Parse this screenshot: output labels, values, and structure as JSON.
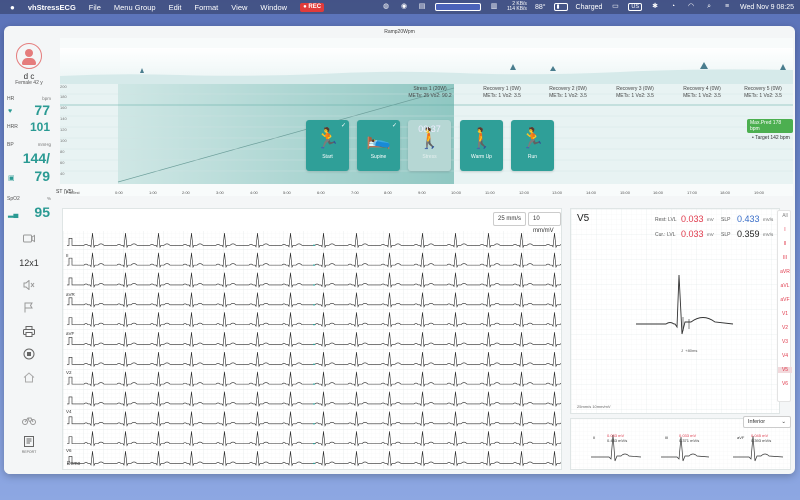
{
  "menubar": {
    "apple": "",
    "app_name": "vhStressECG",
    "menus": [
      "File",
      "Menu Group",
      "Edit",
      "Format",
      "View",
      "Window"
    ],
    "rec": "REC",
    "net_up": "2 KB/s",
    "net_down": "114 KB/s",
    "temperature": "88°",
    "battery": "Charged",
    "input_source": "US",
    "datetime": "Wed Nov 9  08:25"
  },
  "window": {
    "title": "Ramp20Wpm"
  },
  "patient": {
    "name": "d c",
    "info": "Female 42 y"
  },
  "vitals": [
    {
      "label": "HR",
      "unit": "bpm",
      "value": "77",
      "icon": "heart-icon"
    },
    {
      "label": "HRR",
      "unit": "",
      "value": "101",
      "icon": ""
    },
    {
      "label": "BP",
      "unit": "mmHg",
      "value": "144/",
      "icon": ""
    },
    {
      "label": "",
      "unit": "",
      "value": "79",
      "icon": "bp-cuff-icon"
    },
    {
      "label": "SpO2",
      "unit": "%",
      "value": "95",
      "icon": "signal-icon"
    }
  ],
  "sidebar_tools": {
    "video": "video-icon",
    "layout": "12x1",
    "mute": "mute-icon",
    "flag": "flag-icon",
    "print": "print-icon",
    "stop": "stop-icon",
    "home": "home-icon",
    "bike": "bike-icon",
    "report": "report-icon",
    "report_label": "REPORT"
  },
  "protocol": {
    "stages": [
      {
        "label": "Stress 1 (20W)",
        "mets": "METs: 25  Vo2: 90.2"
      },
      {
        "label": "Recovery 1 (0W)",
        "mets": "METs: 1  Vo2: 3.5"
      },
      {
        "label": "Recovery 2 (0W)",
        "mets": "METs: 1  Vo2: 3.5"
      },
      {
        "label": "Recovery 3 (0W)",
        "mets": "METs: 1  Vo2: 3.5"
      },
      {
        "label": "Recovery 4 (0W)",
        "mets": "METs: 1  Vo2: 3.5"
      },
      {
        "label": "Recovery 5 (0W)",
        "mets": "METs: 1  Vo2: 3.5"
      }
    ],
    "cards": [
      {
        "label": "Start",
        "icon": "run-start-icon",
        "checked": true,
        "dim": false
      },
      {
        "label": "Supine",
        "icon": "supine-icon",
        "checked": true,
        "dim": false
      },
      {
        "label": "Stress",
        "icon": "walk-icon",
        "checked": false,
        "dim": true,
        "timer": "00:37"
      },
      {
        "label": "Warm Up",
        "icon": "walk-icon",
        "checked": false,
        "dim": false
      },
      {
        "label": "Run",
        "icon": "run-icon",
        "checked": false,
        "dim": false
      }
    ],
    "max_pred": "Max.Pred 178  bpm",
    "target": "Target  142  bpm",
    "y_axis": [
      "200",
      "180",
      "160",
      "140",
      "120",
      "100",
      "80",
      "60",
      "40",
      "20"
    ],
    "time_label": "PreTest",
    "time_ticks": [
      "0:00",
      "1:00",
      "2:00",
      "3:00",
      "4:00",
      "5:00",
      "6:00",
      "7:00",
      "8:00",
      "9:00",
      "10:00",
      "11:00",
      "12:00",
      "13:00",
      "14:00",
      "15:00",
      "16:00",
      "17:00",
      "18:00",
      "19:00"
    ],
    "st_label": "ST (V5)"
  },
  "ecg": {
    "speed": "25 mm/s",
    "gain": "10 mm/mV",
    "leads": [
      "I",
      "II",
      "III",
      "aVR",
      "aVL",
      "aVF",
      "V1",
      "V2",
      "V3",
      "V4",
      "V5",
      "V6"
    ],
    "visible_leads": [
      "II",
      "aVR",
      "aVF",
      "V2",
      "V4",
      "V6"
    ],
    "demo_label": "Demo"
  },
  "detail": {
    "lead": "V5",
    "rest_label": "Rest: LVL",
    "rest_value": "0.033",
    "rest_unit": "mV",
    "rest_slp_label": "SLP",
    "rest_slp_value": "0.433",
    "rest_slp_unit": "mV/s",
    "cur_label": "Cur.: LVL",
    "cur_value": "0.033",
    "cur_unit": "mV",
    "cur_slp_label": "SLP",
    "cur_slp_value": "0.359",
    "cur_slp_unit": "mV/s",
    "j_label": "J",
    "j_offset": "+80ms",
    "scale": "25mm/s  10mm/mV",
    "lead_list": [
      "All",
      "I",
      "II",
      "III",
      "aVR",
      "aVL",
      "aVF",
      "V1",
      "V2",
      "V3",
      "V4",
      "V5",
      "V6"
    ],
    "active_lead": "V5"
  },
  "mini": {
    "group": "Inferior",
    "items": [
      {
        "lead": "II",
        "lvl": "0.033 mV",
        "slp": "0.433 mV/s"
      },
      {
        "lead": "III",
        "lvl": "0.033 mV",
        "slp": "0.371 mV/s"
      },
      {
        "lead": "aVF",
        "lvl": "0.045 mV",
        "slp": "0.393 mV/s"
      }
    ]
  },
  "colors": {
    "teal": "#2f9f98",
    "red": "#e0394b",
    "blue": "#3a6ec8",
    "green": "#4caf50"
  }
}
